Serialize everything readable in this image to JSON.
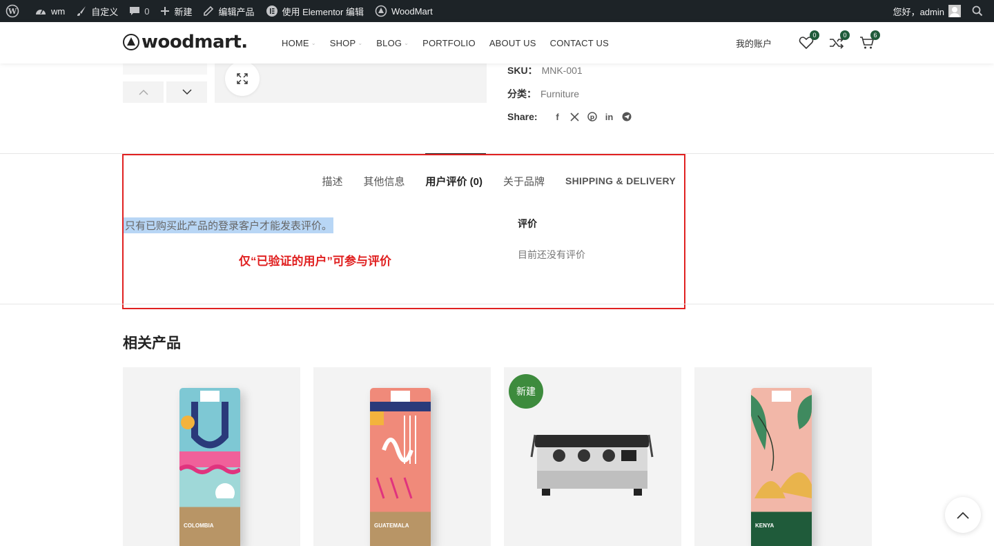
{
  "admin_bar": {
    "site_name": "wm",
    "customize": "自定义",
    "comments_count": "0",
    "new": "新建",
    "edit_product": "编辑产品",
    "elementor_edit": "使用 Elementor 编辑",
    "theme": "WoodMart",
    "greeting": "您好，admin"
  },
  "header": {
    "logo": "woodmart.",
    "nav": [
      {
        "label": "HOME",
        "dropdown": true
      },
      {
        "label": "SHOP",
        "dropdown": true
      },
      {
        "label": "BLOG",
        "dropdown": true
      },
      {
        "label": "PORTFOLIO",
        "dropdown": false
      },
      {
        "label": "ABOUT US",
        "dropdown": false
      },
      {
        "label": "CONTACT US",
        "dropdown": false
      }
    ],
    "account": "我的账户",
    "wishlist_count": "0",
    "compare_count": "0",
    "cart_count": "6"
  },
  "product_meta": {
    "sku_label": "SKU：",
    "sku_value": "MNK-001",
    "category_label": "分类：",
    "category_value": "Furniture",
    "share_label": "Share:"
  },
  "tabs": [
    {
      "label": "描述",
      "active": false
    },
    {
      "label": "其他信息",
      "active": false
    },
    {
      "label": "用户评价 (0)",
      "active": true
    },
    {
      "label": "关于品牌",
      "active": false
    },
    {
      "label": "SHIPPING & DELIVERY",
      "active": false
    }
  ],
  "reviews": {
    "notice": "只有已购买此产品的登录客户才能发表评价。",
    "annotation": "仅“已验证的用户”可参与评价",
    "title": "评价",
    "empty": "目前还没有评价"
  },
  "related": {
    "title": "相关产品",
    "products": [
      {
        "label": "COLOMBIA"
      },
      {
        "label": "GUATEMALA"
      },
      {
        "label": "",
        "badge": "新建"
      },
      {
        "label": "KENYA"
      }
    ]
  },
  "colors": {
    "admin_bar_bg": "#1d2327",
    "badge_green": "#1f5b3a",
    "annotation_red": "#e02020",
    "new_badge_green": "#3d8b3d"
  }
}
